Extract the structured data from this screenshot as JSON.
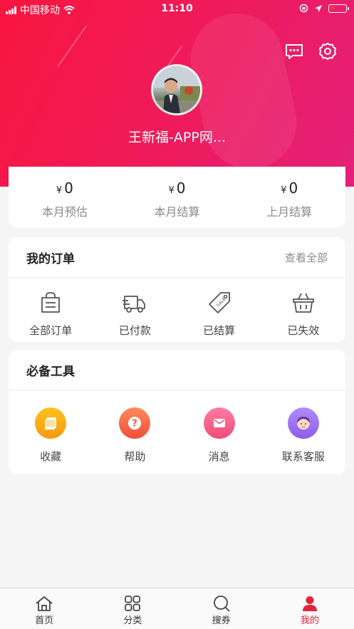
{
  "status_bar": {
    "carrier": "中国移动",
    "time": "11:10"
  },
  "profile": {
    "nickname": "王新福-APP网..."
  },
  "earnings": [
    {
      "currency": "¥",
      "value": "0",
      "label": "本月预估"
    },
    {
      "currency": "¥",
      "value": "0",
      "label": "本月结算"
    },
    {
      "currency": "¥",
      "value": "0",
      "label": "上月结算"
    }
  ],
  "orders": {
    "title": "我的订单",
    "view_all": "查看全部",
    "items": [
      {
        "label": "全部订单",
        "icon": "shopping-bag-icon"
      },
      {
        "label": "已付款",
        "icon": "delivery-truck-icon"
      },
      {
        "label": "已结算",
        "icon": "sale-tag-icon"
      },
      {
        "label": "已失效",
        "icon": "basket-icon"
      }
    ]
  },
  "tools": {
    "title": "必备工具",
    "items": [
      {
        "label": "收藏",
        "icon": "favorites-icon",
        "color": "#f6a316"
      },
      {
        "label": "帮助",
        "icon": "help-icon",
        "color": "#f7604a"
      },
      {
        "label": "消息",
        "icon": "message-icon",
        "color": "#f3577e"
      },
      {
        "label": "联系客服",
        "icon": "customer-service-icon",
        "color": "#9b6ff0"
      }
    ]
  },
  "tab_bar": {
    "items": [
      {
        "label": "首页",
        "icon": "home-icon",
        "active": false
      },
      {
        "label": "分类",
        "icon": "category-icon",
        "active": false
      },
      {
        "label": "搜券",
        "icon": "search-icon",
        "active": false
      },
      {
        "label": "我的",
        "icon": "user-icon",
        "active": true
      }
    ],
    "active_color": "#e8213a"
  },
  "colors": {
    "hero_start": "#f8163f",
    "hero_end": "#e4207a",
    "accent": "#e8213a"
  }
}
